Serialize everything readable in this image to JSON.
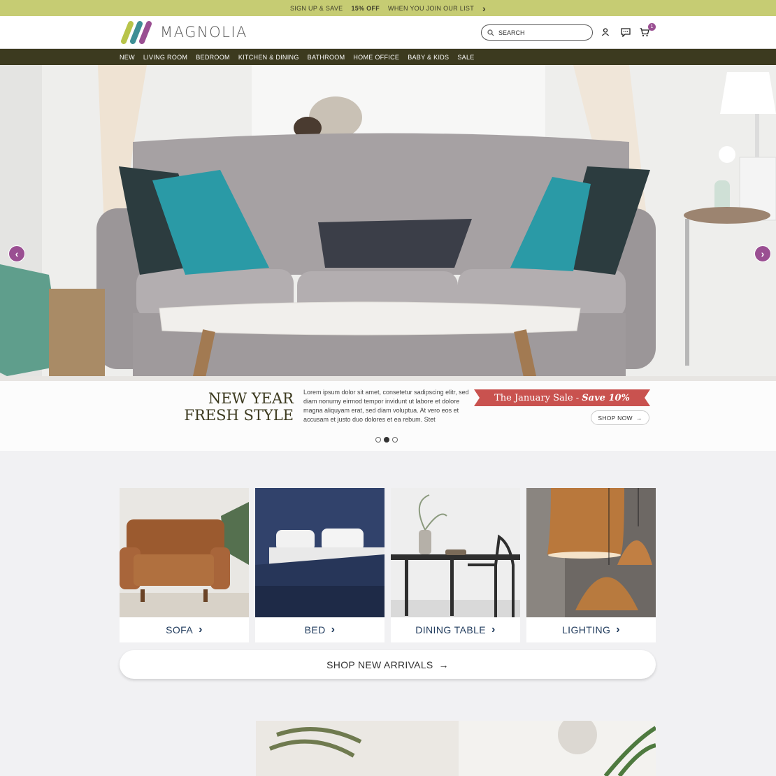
{
  "promo": {
    "text1": "SIGN UP & SAVE",
    "text2": "15% OFF",
    "text3": "WHEN YOU JOIN OUR LIST"
  },
  "header": {
    "brand": "MAGNOLIA",
    "search_placeholder": "SEARCH",
    "cart_count": "1"
  },
  "nav": [
    "NEW",
    "LIVING ROOM",
    "BEDROOM",
    "KITCHEN & DINING",
    "BATHROOM",
    "HOME OFFICE",
    "BABY & KIDS",
    "SALE"
  ],
  "hero": {
    "title_line1": "NEW YEAR",
    "title_line2": "FRESH STYLE",
    "copy": "Lorem ipsum dolor sit amet, consetetur sadipscing elitr, sed diam nonumy eirmod tempor invidunt ut labore et dolore magna aliquyam erat, sed diam voluptua. At vero eos et accusam et justo duo dolores et ea rebum. Stet",
    "sale_text": "The January Sale - ",
    "sale_emph": "Save 10%",
    "shop_now": "SHOP NOW",
    "slides": 3,
    "active_slide": 2
  },
  "categories": [
    {
      "label": "SOFA"
    },
    {
      "label": "BED"
    },
    {
      "label": "DINING TABLE"
    },
    {
      "label": "LIGHTING"
    }
  ],
  "arrivals_label": "SHOP NEW ARRIVALS",
  "colors": {
    "promo": "#c6cc73",
    "nav": "#3c3a1f",
    "accent": "#9a4f92",
    "sale": "#c9524f",
    "category_text": "#1f3a5c"
  }
}
